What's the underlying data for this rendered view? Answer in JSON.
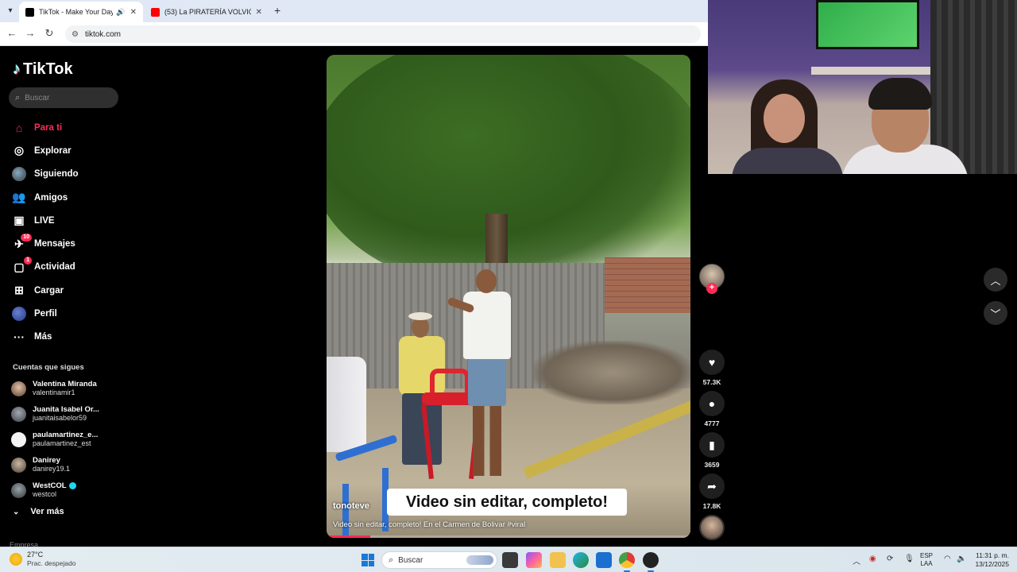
{
  "browser": {
    "tabs": [
      {
        "title": "TikTok - Make Your Day",
        "active": true
      },
      {
        "title": "(53) La PIRATERÍA VOLVIÓ, el ST",
        "active": false
      }
    ],
    "new_tab_symbol": "+",
    "url": "tiktok.com"
  },
  "tiktok": {
    "logo_text": "TikTok",
    "search": {
      "placeholder": "Buscar"
    },
    "nav": [
      {
        "label": "Para ti",
        "icon": "home-icon",
        "active": true
      },
      {
        "label": "Explorar",
        "icon": "compass-icon"
      },
      {
        "label": "Siguiendo",
        "icon": "avatar-icon"
      },
      {
        "label": "Amigos",
        "icon": "friends-icon"
      },
      {
        "label": "LIVE",
        "icon": "live-icon"
      },
      {
        "label": "Mensajes",
        "icon": "messages-icon",
        "badge": "10"
      },
      {
        "label": "Actividad",
        "icon": "activity-icon",
        "badge": "1"
      },
      {
        "label": "Cargar",
        "icon": "upload-icon"
      },
      {
        "label": "Perfil",
        "icon": "profile-icon"
      },
      {
        "label": "Más",
        "icon": "more-icon"
      }
    ],
    "following_header": "Cuentas que sigues",
    "following": [
      {
        "name": "Valentina Miranda",
        "user": "valentinamir1"
      },
      {
        "name": "Juanita Isabel Or...",
        "user": "juanitaisabelor59"
      },
      {
        "name": "paulamartinez_e...",
        "user": "paulamartinez_est"
      },
      {
        "name": "Danirey",
        "user": "danirey19.1"
      },
      {
        "name": "WestCOL",
        "user": "westcol",
        "verified": true
      }
    ],
    "see_more": "Ver más",
    "footer_partial": "Empresa"
  },
  "video": {
    "caption_overlay": "Video sin editar, completo!",
    "author": "tonoteve",
    "description": "Video sin editar, completo! En el Carmen de Bolivar #viral",
    "progress": 0.12
  },
  "actions": {
    "likes": "57.3K",
    "comments": "4777",
    "saves": "3659",
    "shares": "17.8K"
  },
  "taskbar": {
    "temp": "27°C",
    "weather": "Prac. despejado",
    "search_placeholder": "Buscar",
    "lang_top": "ESP",
    "lang_bottom": "LAA",
    "time": "11:31 p. m.",
    "date": "13/12/2025"
  },
  "colors": {
    "accent": "#fe2c55",
    "background": "#000000"
  }
}
